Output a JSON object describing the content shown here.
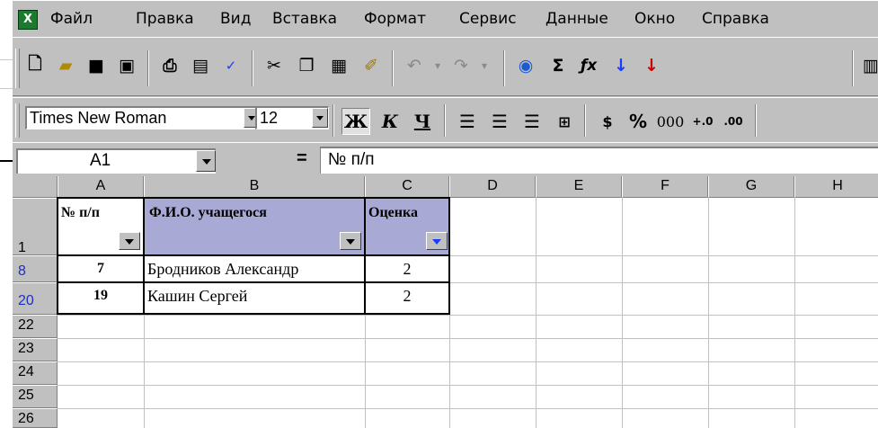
{
  "menu": {
    "app_icon": "excel-icon",
    "items": [
      "Файл",
      "Правка",
      "Вид",
      "Вставка",
      "Формат",
      "Сервис",
      "Данные",
      "Окно",
      "Справка"
    ]
  },
  "toolbar_standard": {
    "icons": [
      "new-icon",
      "open-icon",
      "save-icon",
      "permissions-icon",
      "print-icon",
      "print-preview-icon",
      "spelling-icon",
      "cut-icon",
      "copy-icon",
      "paste-icon",
      "format-painter-icon",
      "undo-icon",
      "redo-icon",
      "web-icon",
      "autosum-icon",
      "function-icon",
      "sort-ascending-icon",
      "sort-descending-icon",
      "chart-wizard-icon"
    ]
  },
  "toolbar_format": {
    "font_name": "Times New Roman",
    "font_size": "12",
    "bold_label": "Ж",
    "italic_label": "К",
    "underline_label": "Ч",
    "percent_label": "%",
    "thousands_label": "000"
  },
  "formula_bar": {
    "name_box": "A1",
    "equals": "=",
    "formula": "№ п/п"
  },
  "grid": {
    "columns": [
      "A",
      "B",
      "C",
      "D",
      "E",
      "F",
      "G",
      "H"
    ],
    "rows": [
      {
        "num": "1",
        "filtered": false
      },
      {
        "num": "8",
        "filtered": true
      },
      {
        "num": "20",
        "filtered": true
      },
      {
        "num": "22",
        "filtered": false
      },
      {
        "num": "23",
        "filtered": false
      },
      {
        "num": "24",
        "filtered": false
      },
      {
        "num": "25",
        "filtered": false
      },
      {
        "num": "26",
        "filtered": false
      }
    ],
    "header_cells": [
      "№ п/п",
      "Ф.И.О. учащегося",
      "Оценка"
    ],
    "data_rows": [
      [
        "7",
        "Бродников Александр",
        "2"
      ],
      [
        "19",
        "Кашин  Сергей",
        "2"
      ]
    ]
  },
  "colors": {
    "chrome": "#c0c0c0",
    "header_fill": "#a9a9d6",
    "filtered_row_number": "#1f2fbf"
  }
}
